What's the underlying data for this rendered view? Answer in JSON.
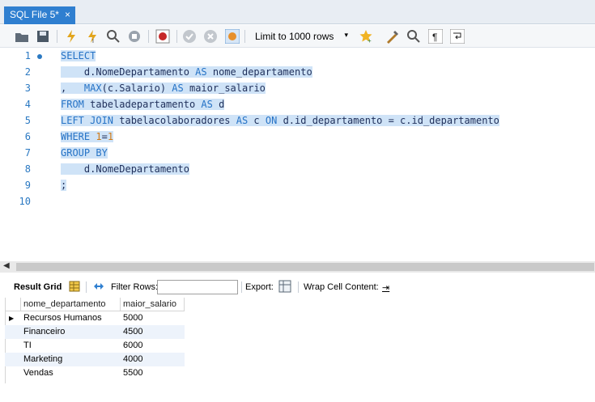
{
  "tab": {
    "title": "SQL File 5*",
    "close": "×"
  },
  "toolbar": {
    "limit_label": "Limit to 1000 rows",
    "limit_arrow": "▾"
  },
  "editor": {
    "line_numbers": [
      "1",
      "2",
      "3",
      "4",
      "5",
      "6",
      "7",
      "8",
      "9",
      "10"
    ],
    "lines": [
      [
        {
          "t": "SELECT",
          "c": "kw"
        }
      ],
      [
        {
          "t": "    d.NomeDepartamento ",
          "c": "txt"
        },
        {
          "t": "AS",
          "c": "kw"
        },
        {
          "t": " nome_departamento",
          "c": "txt"
        }
      ],
      [
        {
          "t": ",   ",
          "c": "txt"
        },
        {
          "t": "MAX",
          "c": "kw"
        },
        {
          "t": "(c.Salario) ",
          "c": "txt"
        },
        {
          "t": "AS",
          "c": "kw"
        },
        {
          "t": " maior_salario",
          "c": "txt"
        }
      ],
      [
        {
          "t": "FROM",
          "c": "kw"
        },
        {
          "t": " tabeladepartamento ",
          "c": "txt"
        },
        {
          "t": "AS",
          "c": "kw"
        },
        {
          "t": " d",
          "c": "txt"
        }
      ],
      [
        {
          "t": "LEFT JOIN",
          "c": "kw"
        },
        {
          "t": " tabelacolaboradores ",
          "c": "txt"
        },
        {
          "t": "AS",
          "c": "kw"
        },
        {
          "t": " c ",
          "c": "txt"
        },
        {
          "t": "ON",
          "c": "kw"
        },
        {
          "t": " d.id_departamento = c.id_departamento",
          "c": "txt"
        }
      ],
      [
        {
          "t": "WHERE",
          "c": "kw"
        },
        {
          "t": " ",
          "c": "txt"
        },
        {
          "t": "1",
          "c": "num"
        },
        {
          "t": "=",
          "c": "txt"
        },
        {
          "t": "1",
          "c": "num"
        }
      ],
      [
        {
          "t": "GROUP BY",
          "c": "kw"
        }
      ],
      [
        {
          "t": "    d.NomeDepartamento",
          "c": "txt"
        }
      ],
      [
        {
          "t": ";",
          "c": "txt"
        }
      ],
      []
    ]
  },
  "result_toolbar": {
    "result_grid": "Result Grid",
    "filter_rows": "Filter Rows:",
    "export": "Export:",
    "wrap_cell": "Wrap Cell Content:",
    "wrap_icon": "⇥"
  },
  "grid": {
    "columns": [
      "nome_departamento",
      "maior_salario"
    ],
    "rows": [
      [
        "Recursos Humanos",
        "5000"
      ],
      [
        "Financeiro",
        "4500"
      ],
      [
        "TI",
        "6000"
      ],
      [
        "Marketing",
        "4000"
      ],
      [
        "Vendas",
        "5500"
      ]
    ],
    "row_marker": "▶"
  },
  "colors": {
    "tab_active": "#2f7fd0",
    "selection": "#cfe3f7",
    "keyword": "#2673c6",
    "number": "#d17a15"
  }
}
